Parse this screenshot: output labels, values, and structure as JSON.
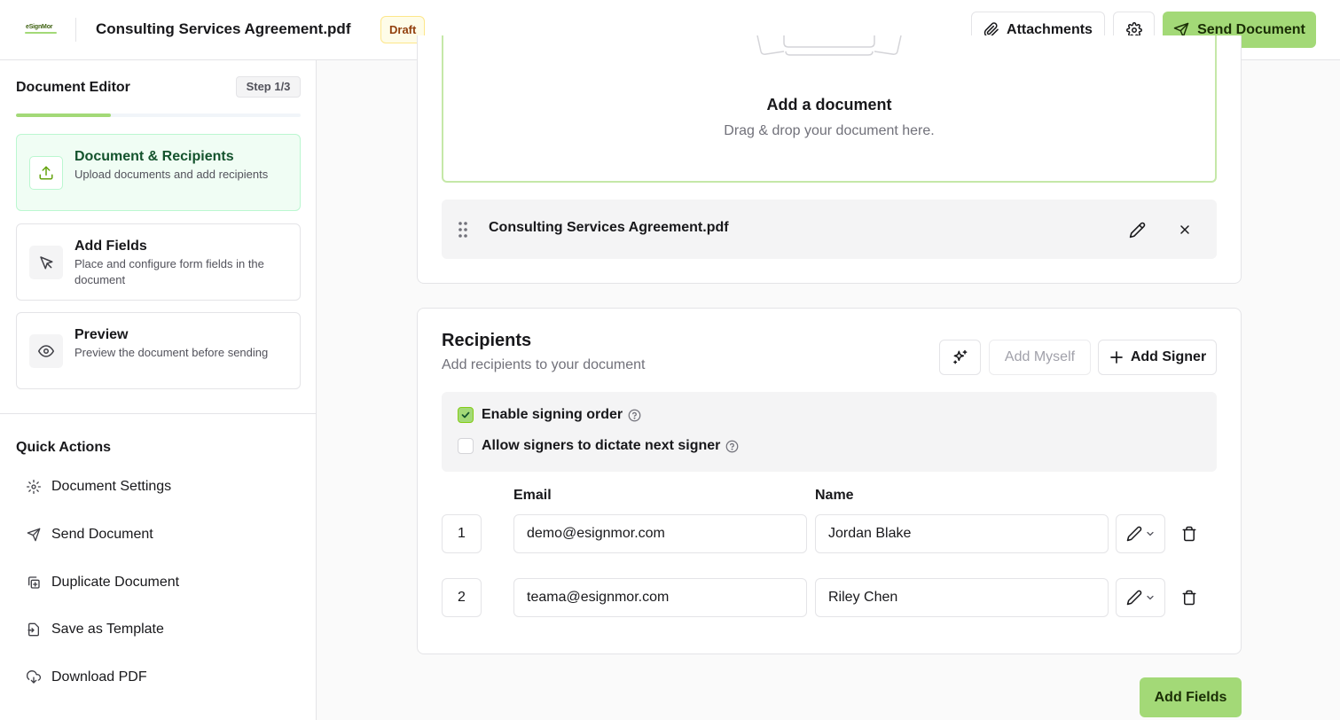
{
  "header": {
    "logo_text": "eSignMor",
    "doc_title": "Consulting Services Agreement.pdf",
    "status_badge": "Draft",
    "attachments_label": "Attachments",
    "send_label": "Send Document"
  },
  "sidebar": {
    "title": "Document Editor",
    "step_badge": "Step 1/3",
    "progress": 0.333,
    "steps": [
      {
        "title": "Document & Recipients",
        "desc": "Upload documents and add recipients",
        "icon": "upload-icon",
        "active": true
      },
      {
        "title": "Add Fields",
        "desc": "Place and configure form fields in the document",
        "icon": "cursor-icon",
        "active": false
      },
      {
        "title": "Preview",
        "desc": "Preview the document before sending",
        "icon": "eye-icon",
        "active": false
      }
    ],
    "quick_actions_title": "Quick Actions",
    "quick_actions": [
      {
        "label": "Document Settings",
        "icon": "gear-icon"
      },
      {
        "label": "Send Document",
        "icon": "send-icon"
      },
      {
        "label": "Duplicate Document",
        "icon": "duplicate-icon"
      },
      {
        "label": "Save as Template",
        "icon": "template-icon"
      },
      {
        "label": "Download PDF",
        "icon": "download-icon"
      }
    ]
  },
  "upload": {
    "title": "Add a document",
    "subtitle": "Drag & drop your document here.",
    "file_name": "Consulting Services Agreement.pdf"
  },
  "recipients": {
    "title": "Recipients",
    "subtitle": "Add recipients to your document",
    "add_myself_label": "Add Myself",
    "add_signer_label": "Add Signer",
    "signing_order_label": "Enable signing order",
    "signing_order_checked": true,
    "dictate_label": "Allow signers to dictate next signer",
    "dictate_checked": false,
    "email_header": "Email",
    "name_header": "Name",
    "signers": [
      {
        "order": "1",
        "email": "demo@esignmor.com",
        "name": "Jordan Blake",
        "role_icon": "pen-icon"
      },
      {
        "order": "2",
        "email": "teama@esignmor.com",
        "name": "Riley Chen",
        "role_icon": "pen-icon"
      }
    ]
  },
  "footer": {
    "add_fields_label": "Add Fields"
  },
  "colors": {
    "accent": "#a3d977",
    "active_step_bg": "#f0fdf4",
    "badge_bg": "#fefce8"
  }
}
